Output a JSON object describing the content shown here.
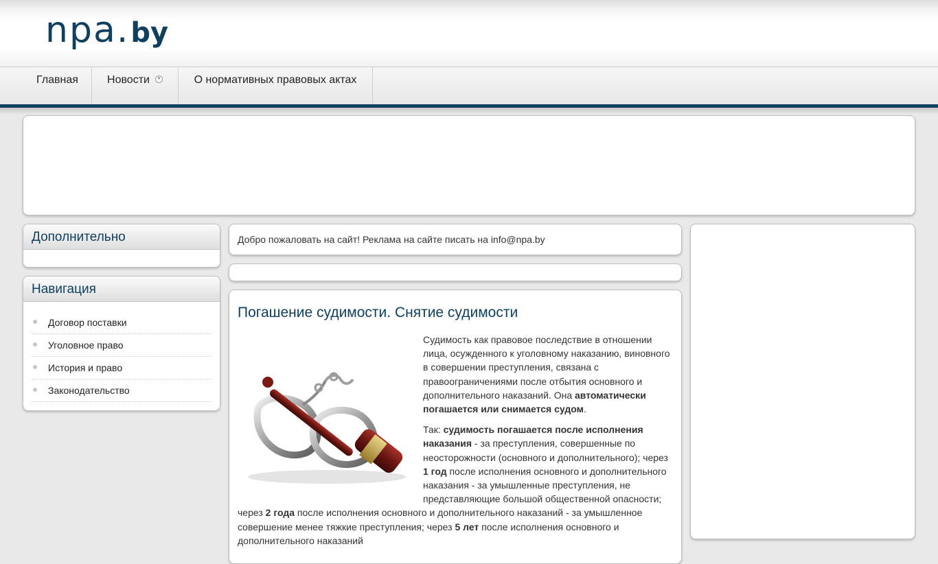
{
  "site": {
    "logo_main": "npa",
    "logo_domain": "by"
  },
  "menu": {
    "home": "Главная",
    "news": "Новости",
    "about": "О нормативных правовых актах"
  },
  "sidebar": {
    "extra_title": "Дополнительно",
    "nav_title": "Навигация",
    "nav_items": [
      {
        "label": "Договор поставки"
      },
      {
        "label": "Уголовное право"
      },
      {
        "label": "История и право"
      },
      {
        "label": "Законодательство"
      }
    ]
  },
  "welcome_text": "Добро пожаловать на сайт! Реклама на сайте писать на info@npa.by",
  "article": {
    "title": "Погашение судимости. Снятие судимости",
    "image_alt": "gavel-and-handcuffs",
    "p1_a": "Судимость как правовое последствие в отношении лица, осужденного к уголовному наказанию, виновного в совершении преступления, связана с правоограничениями после отбытия основного и дополнительного наказаний. Она ",
    "p1_b": "автоматически погашается или снимается судом",
    "p1_c": ".",
    "p2_a": "Так: ",
    "p2_b": "судимость погашается после исполнения наказания",
    "p2_c": " - за преступления, совершенные по неосторожности (основного и дополнительного); через ",
    "p2_d": "1 год",
    "p2_e": " после исполнения основного и дополнительного наказания - за умышленные преступления, не представляющие большой общественной опасности; через ",
    "p2_f": "2 года",
    "p2_g": " после исполнения основного и дополнительного наказаний - за умышленное совершение менее тяжкие преступления; через ",
    "p2_h": "5 лет",
    "p2_i": " после исполнения основного и дополнительного наказаний"
  },
  "colors": {
    "brand": "#11405e",
    "background": "#e9e9e9"
  }
}
